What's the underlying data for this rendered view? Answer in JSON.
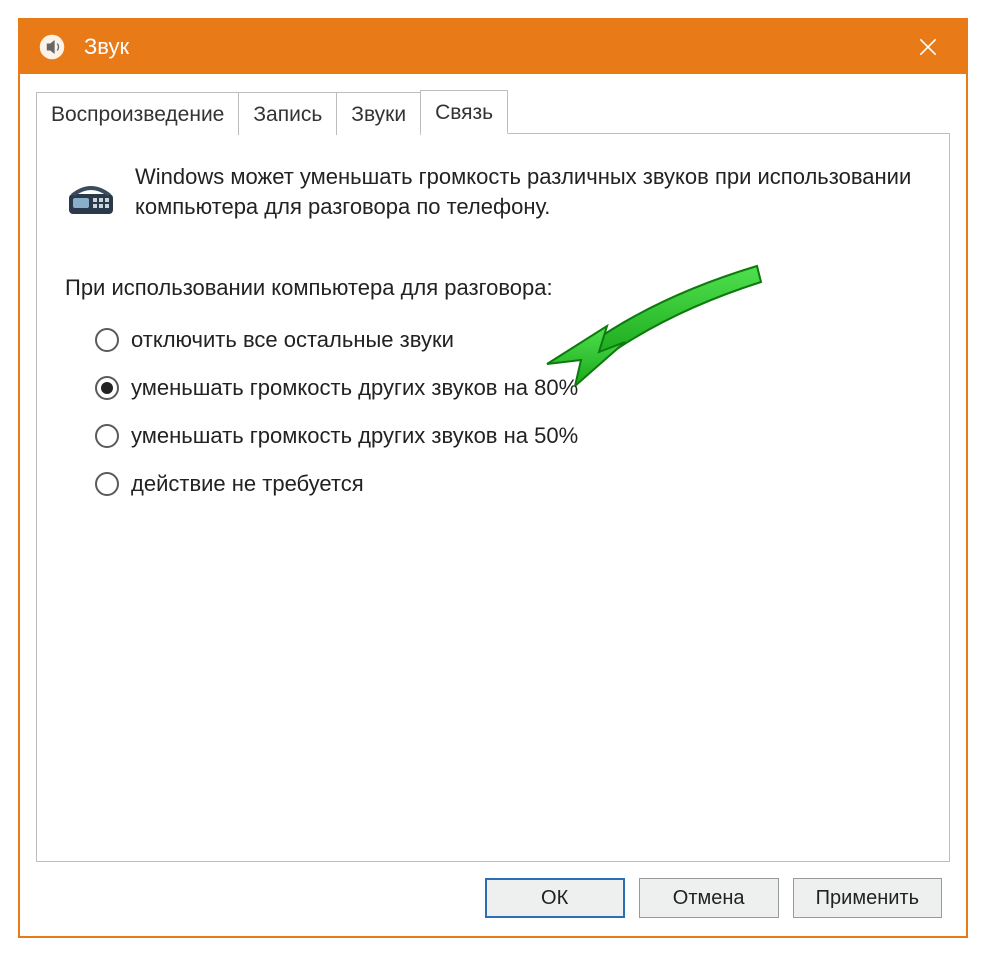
{
  "window": {
    "title": "Звук"
  },
  "tabs": [
    {
      "label": "Воспроизведение",
      "active": false
    },
    {
      "label": "Запись",
      "active": false
    },
    {
      "label": "Звуки",
      "active": false
    },
    {
      "label": "Связь",
      "active": true
    }
  ],
  "communications": {
    "description": "Windows может уменьшать громкость различных звуков при использовании компьютера для разговора по телефону.",
    "section_label": "При использовании компьютера для разговора:",
    "options": [
      {
        "label": "отключить все остальные звуки",
        "selected": false
      },
      {
        "label": "уменьшать громкость других звуков на 80%",
        "selected": true
      },
      {
        "label": "уменьшать громкость других звуков на 50%",
        "selected": false
      },
      {
        "label": "действие не требуется",
        "selected": false
      }
    ]
  },
  "buttons": {
    "ok": "ОК",
    "cancel": "Отмена",
    "apply": "Применить"
  }
}
